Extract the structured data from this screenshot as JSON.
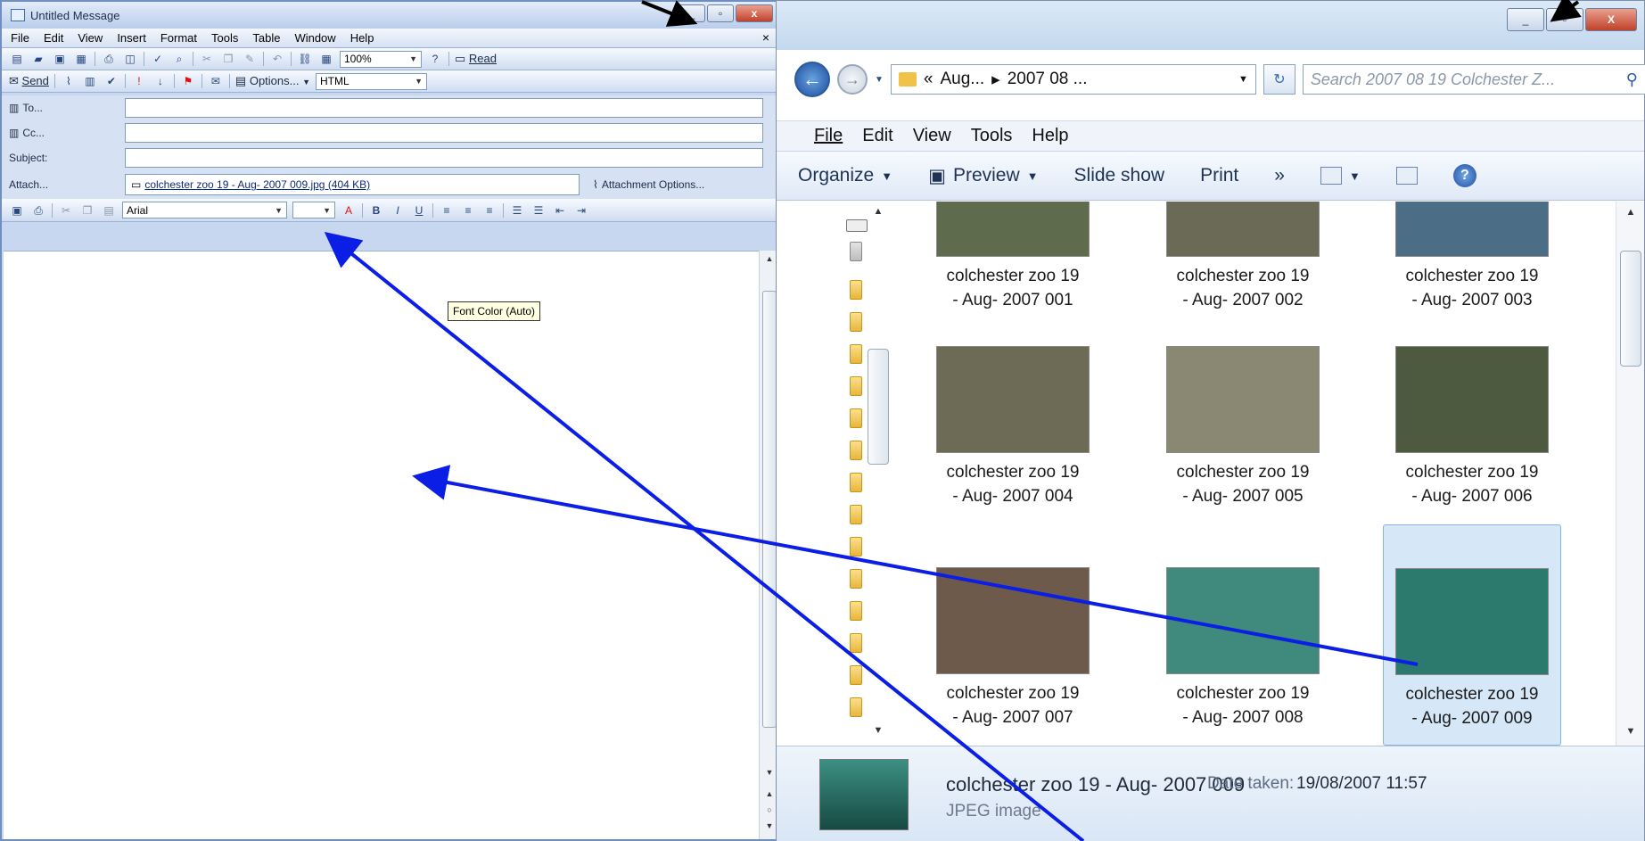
{
  "outlook": {
    "title": "Untitled Message",
    "menu": [
      "File",
      "Edit",
      "View",
      "Insert",
      "Format",
      "Tools",
      "Table",
      "Window",
      "Help"
    ],
    "menu_close": "×",
    "zoom": "100%",
    "read_label": "Read",
    "send_label": "Send",
    "options_label": "Options...",
    "format": "HTML",
    "to_label": "To...",
    "cc_label": "Cc...",
    "subject_label": "Subject:",
    "attach_label": "Attach...",
    "attachment": "colchester zoo 19 - Aug- 2007 009.jpg (404 KB)",
    "attachment_options": "Attachment Options...",
    "font": "Arial",
    "tooltip": "Font Color (Auto)"
  },
  "explorer": {
    "address": [
      "«",
      "Aug...",
      "▸",
      "2007 08 ..."
    ],
    "search_placeholder": "Search 2007 08 19 Colchester Z...",
    "menu": [
      "File",
      "Edit",
      "View",
      "Tools",
      "Help"
    ],
    "commands": {
      "organize": "Organize",
      "preview": "Preview",
      "slideshow": "Slide show",
      "print": "Print",
      "more": "»"
    },
    "files": [
      {
        "line1": "colchester zoo 19",
        "line2": "- Aug- 2007 001",
        "color": "#5e6b4d"
      },
      {
        "line1": "colchester zoo 19",
        "line2": "- Aug- 2007 002",
        "color": "#6b6a57"
      },
      {
        "line1": "colchester zoo 19",
        "line2": "- Aug- 2007 003",
        "color": "#4b6e86"
      },
      {
        "line1": "colchester zoo 19",
        "line2": "- Aug- 2007 004",
        "color": "#6d6b55"
      },
      {
        "line1": "colchester zoo 19",
        "line2": "- Aug- 2007 005",
        "color": "#8a8872"
      },
      {
        "line1": "colchester zoo 19",
        "line2": "- Aug- 2007 006",
        "color": "#4e5a3f"
      },
      {
        "line1": "colchester zoo 19",
        "line2": "- Aug- 2007 007",
        "color": "#6d5a4a"
      },
      {
        "line1": "colchester zoo 19",
        "line2": "- Aug- 2007 008",
        "color": "#3f8a7c"
      },
      {
        "line1": "colchester zoo 19",
        "line2": "- Aug- 2007 009",
        "color": "#2b7a6d"
      }
    ],
    "details": {
      "name": "colchester zoo 19 - Aug- 2007 009",
      "date_label": "Date taken:",
      "date_value": "19/08/2007 11:57",
      "type": "JPEG image"
    }
  },
  "colors": {
    "arrow": "#0a1ee6",
    "black_arrow": "#000000"
  }
}
